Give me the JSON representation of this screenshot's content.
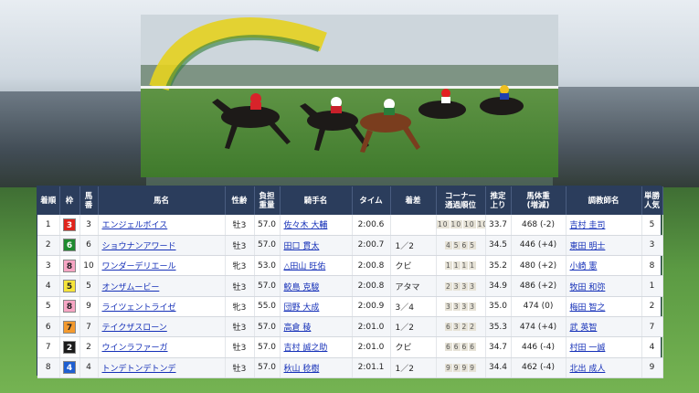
{
  "table": {
    "headers": {
      "rank": "着順",
      "waku": "枠",
      "horse_no_1": "馬",
      "horse_no_2": "番",
      "horse_name": "馬名",
      "sex_age": "性齢",
      "weight_1": "負担",
      "weight_2": "重量",
      "jockey": "騎手名",
      "time": "タイム",
      "margin": "着差",
      "corner_1": "コーナー",
      "corner_2": "通過順位",
      "last3f_1": "推定",
      "last3f_2": "上り",
      "body_weight_1": "馬体重",
      "body_weight_2": "(増減)",
      "trainer": "調教師名",
      "popularity_1": "単勝",
      "popularity_2": "人気"
    },
    "rows": [
      {
        "rank": "1",
        "waku": "3",
        "waku_bg": "#e0241b",
        "waku_fg": "#ffffff",
        "no": "3",
        "horse": "エンジェルボイス",
        "sexage": "牡3",
        "weight": "57.0",
        "jockey": "佐々木 大輔",
        "time": "2:00.6",
        "margin": "",
        "corners": [
          "10",
          "10",
          "10",
          "10"
        ],
        "last3f": "33.7",
        "body": "468 (-2)",
        "trainer": "吉村 圭司",
        "pop": "5"
      },
      {
        "rank": "2",
        "waku": "6",
        "waku_bg": "#1e8a2f",
        "waku_fg": "#ffffff",
        "no": "6",
        "horse": "ショウナンアワード",
        "sexage": "牡3",
        "weight": "57.0",
        "jockey": "田口 貫太",
        "time": "2:00.7",
        "margin": "1／2",
        "corners": [
          "4",
          "5",
          "6",
          "5"
        ],
        "last3f": "34.5",
        "body": "446 (+4)",
        "trainer": "東田 明士",
        "pop": "3"
      },
      {
        "rank": "3",
        "waku": "8",
        "waku_bg": "#f7a6c4",
        "waku_fg": "#222222",
        "no": "10",
        "horse": "ワンダーデリエール",
        "sexage": "牝3",
        "weight": "53.0",
        "jockey": "△田山 旺佑",
        "time": "2:00.8",
        "margin": "クビ",
        "corners": [
          "1",
          "1",
          "1",
          "1"
        ],
        "last3f": "35.2",
        "body": "480 (+2)",
        "trainer": "小崎 憲",
        "pop": "8"
      },
      {
        "rank": "4",
        "waku": "5",
        "waku_bg": "#f6e43a",
        "waku_fg": "#222222",
        "no": "5",
        "horse": "オンザムービー",
        "sexage": "牡3",
        "weight": "57.0",
        "jockey": "鮫島 克駿",
        "time": "2:00.8",
        "margin": "アタマ",
        "corners": [
          "2",
          "3",
          "3",
          "3"
        ],
        "last3f": "34.9",
        "body": "486 (+2)",
        "trainer": "牧田 和弥",
        "pop": "1"
      },
      {
        "rank": "5",
        "waku": "8",
        "waku_bg": "#f7a6c4",
        "waku_fg": "#222222",
        "no": "9",
        "horse": "ライツェントライゼ",
        "sexage": "牝3",
        "weight": "55.0",
        "jockey": "団野 大成",
        "time": "2:00.9",
        "margin": "3／4",
        "corners": [
          "3",
          "3",
          "3",
          "3"
        ],
        "last3f": "35.0",
        "body": "474 (0)",
        "trainer": "梅田 智之",
        "pop": "2"
      },
      {
        "rank": "6",
        "waku": "7",
        "waku_bg": "#f49a2e",
        "waku_fg": "#222222",
        "no": "7",
        "horse": "テイクザスローン",
        "sexage": "牡3",
        "weight": "57.0",
        "jockey": "高倉 稜",
        "time": "2:01.0",
        "margin": "1／2",
        "corners": [
          "6",
          "3",
          "2",
          "2"
        ],
        "last3f": "35.3",
        "body": "474 (+4)",
        "trainer": "武 英智",
        "pop": "7"
      },
      {
        "rank": "7",
        "waku": "2",
        "waku_bg": "#1a1a1a",
        "waku_fg": "#ffffff",
        "no": "2",
        "horse": "ウインラファーガ",
        "sexage": "牡3",
        "weight": "57.0",
        "jockey": "吉村 誠之助",
        "time": "2:01.0",
        "margin": "クビ",
        "corners": [
          "6",
          "6",
          "6",
          "6"
        ],
        "last3f": "34.7",
        "body": "446 (-4)",
        "trainer": "村田 一誠",
        "pop": "4"
      },
      {
        "rank": "8",
        "waku": "4",
        "waku_bg": "#1f5fd0",
        "waku_fg": "#ffffff",
        "no": "4",
        "horse": "トンデトンデトンデ",
        "sexage": "牡3",
        "weight": "57.0",
        "jockey": "秋山 稔樹",
        "time": "2:01.1",
        "margin": "1／2",
        "corners": [
          "9",
          "9",
          "9",
          "9"
        ],
        "last3f": "34.4",
        "body": "462 (-4)",
        "trainer": "北出 成人",
        "pop": "9"
      }
    ]
  }
}
